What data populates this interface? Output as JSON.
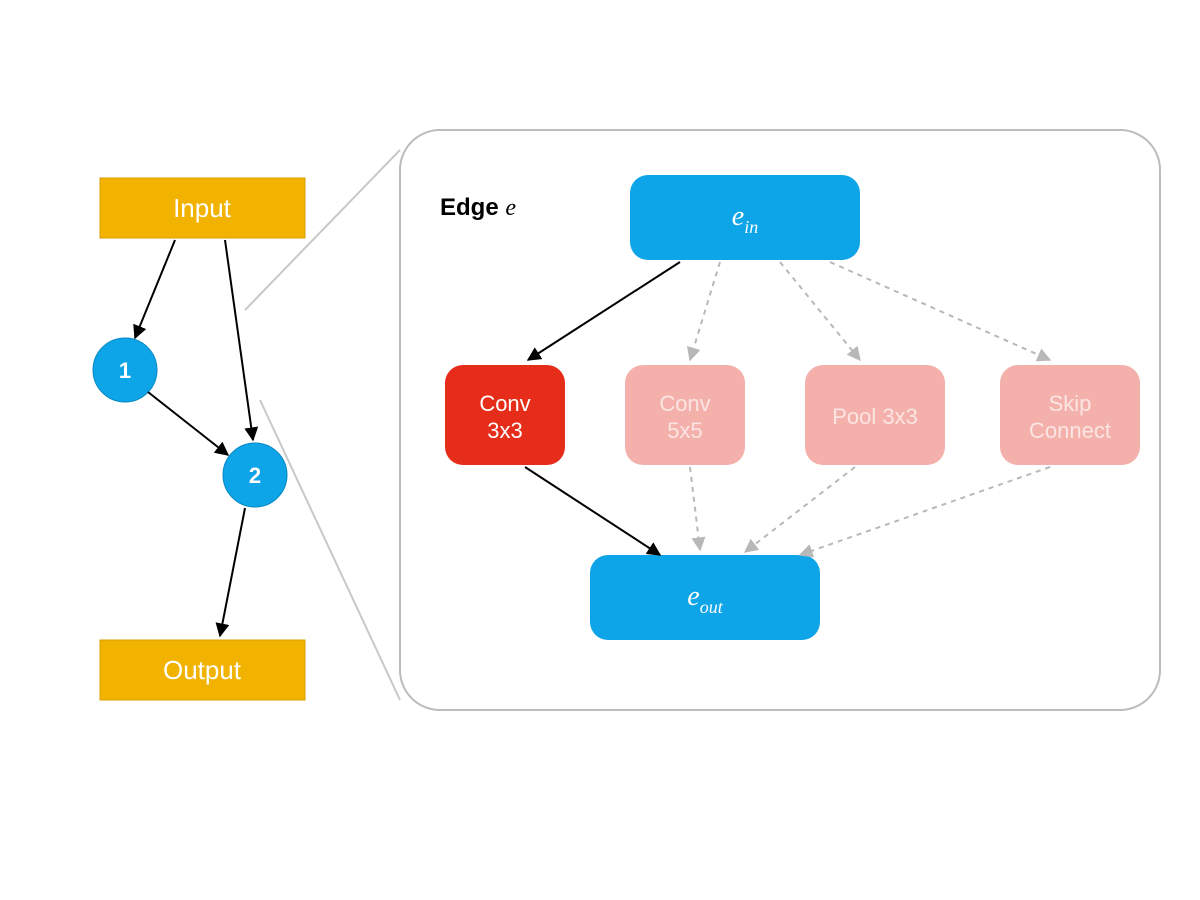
{
  "left": {
    "input": "Input",
    "output": "Output",
    "node1": "1",
    "node2": "2"
  },
  "panel": {
    "title_prefix": "Edge ",
    "title_var": "e",
    "e_in_base": "e",
    "e_in_sub": "in",
    "e_out_base": "e",
    "e_out_sub": "out",
    "ops": {
      "conv3_l1": "Conv",
      "conv3_l2": "3x3",
      "conv5_l1": "Conv",
      "conv5_l2": "5x5",
      "pool_l1": "Pool 3x3",
      "skip_l1": "Skip",
      "skip_l2": "Connect"
    }
  },
  "colors": {
    "yellow": "#f2b200",
    "blue": "#0ea4e8",
    "red": "#e62d19",
    "pink": "#f4b1ac",
    "panel_stroke": "#bcbcbc"
  }
}
